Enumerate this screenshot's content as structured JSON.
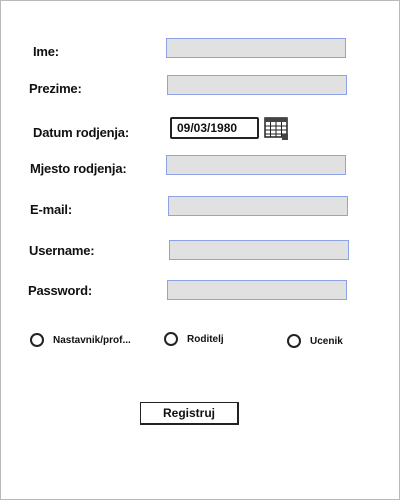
{
  "form": {
    "fields": [
      {
        "label": "Ime:",
        "value": ""
      },
      {
        "label": "Prezime:",
        "value": ""
      },
      {
        "label": "Mjesto rodjenja:",
        "value": ""
      },
      {
        "label": "E-mail:",
        "value": ""
      },
      {
        "label": "Username:",
        "value": ""
      },
      {
        "label": "Password:",
        "value": ""
      }
    ],
    "birthdate": {
      "label": "Datum rodjenja:",
      "value": "09/03/1980"
    },
    "roles": [
      "Nastavnik/prof...",
      "Roditelj",
      "Ucenik"
    ],
    "submit_label": "Registruj"
  },
  "colors": {
    "field_fill": "#e1e1e1",
    "field_border": "#8ea3e6",
    "ink": "#222222"
  },
  "icons": {
    "calendar": "calendar-icon"
  }
}
